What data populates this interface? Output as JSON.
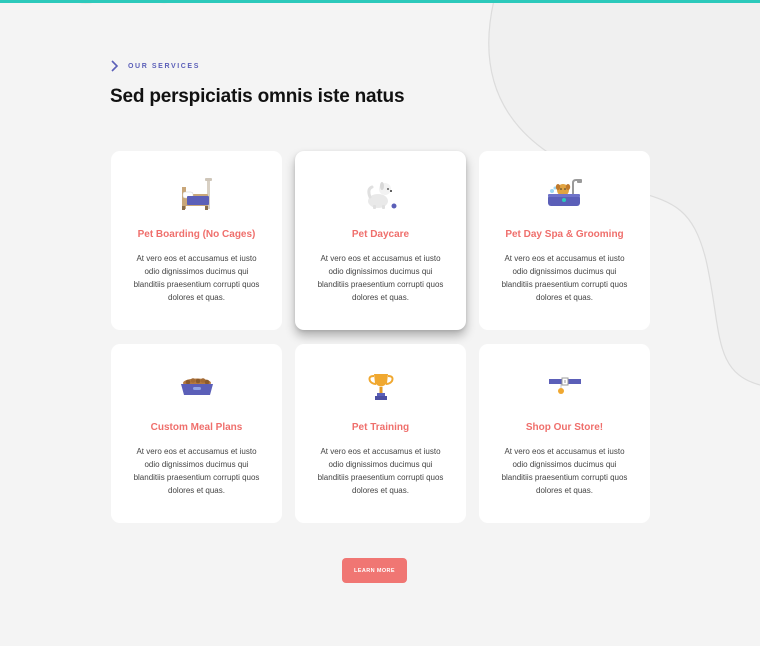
{
  "section": {
    "eyebrow": "OUR SERVICES",
    "heading": "Sed perspiciatis omnis iste natus"
  },
  "services": [
    {
      "title": "Pet Boarding (No Cages)",
      "text": "At vero eos et accusamus et iusto odio dignissimos ducimus qui blanditiis praesentium corrupti quos dolores et quas.",
      "icon": "bed-icon"
    },
    {
      "title": "Pet Daycare",
      "text": "At vero eos et accusamus et iusto odio dignissimos ducimus qui blanditiis praesentium corrupti quos dolores et quas.",
      "icon": "dog-icon"
    },
    {
      "title": "Pet Day Spa & Grooming",
      "text": "At vero eos et accusamus et iusto odio dignissimos ducimus qui blanditiis praesentium corrupti quos dolores et quas.",
      "icon": "bathtub-icon"
    },
    {
      "title": "Custom Meal Plans",
      "text": "At vero eos et accusamus et iusto odio dignissimos ducimus qui blanditiis praesentium corrupti quos dolores et quas.",
      "icon": "food-bowl-icon"
    },
    {
      "title": "Pet Training",
      "text": "At vero eos et accusamus et iusto odio dignissimos ducimus qui blanditiis praesentium corrupti quos dolores et quas.",
      "icon": "trophy-icon"
    },
    {
      "title": "Shop Our Store!",
      "text": "At vero eos et accusamus et iusto odio dignissimos ducimus qui blanditiis praesentium corrupti quos dolores et quas.",
      "icon": "collar-icon"
    }
  ],
  "cta": {
    "label": "LEARN MORE"
  },
  "colors": {
    "accent": "#ef6f6c",
    "brand_purple": "#5b5fb8",
    "teal": "#2cc9bb",
    "background": "#f4f4f4"
  }
}
